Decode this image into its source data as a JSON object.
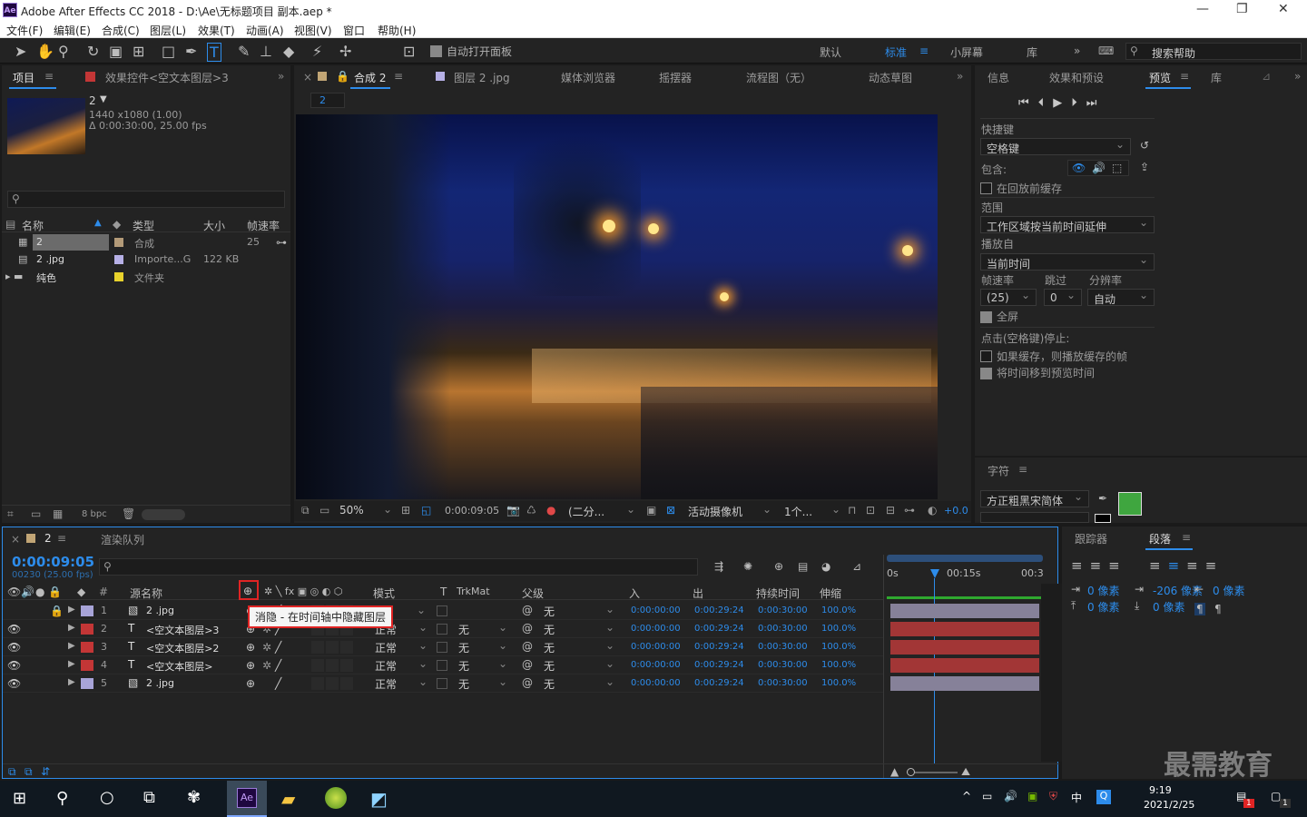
{
  "app": {
    "title": "Adobe After Effects CC 2018 - D:\\Ae\\无标题项目 副本.aep *",
    "logo_text": "Ae",
    "window_controls": [
      "—",
      "❐",
      "✕"
    ]
  },
  "menu": [
    "文件(F)",
    "编辑(E)",
    "合成(C)",
    "图层(L)",
    "效果(T)",
    "动画(A)",
    "视图(V)",
    "窗口",
    "帮助(H)"
  ],
  "toolbar": {
    "auto_open_label": "自动打开面板",
    "workspaces": [
      "默认",
      "标准",
      "小屏幕",
      "库"
    ],
    "active_workspace": "标准",
    "search_placeholder": "搜索帮助"
  },
  "project_panel": {
    "tab_project": "项目",
    "tab_effects": "效果控件<空文本图层>3",
    "selected_name": "2",
    "selected_info_1": "1440 x1080 (1.00)",
    "selected_info_2": "Δ 0:00:30:00, 25.00 fps",
    "columns": [
      "名称",
      "类型",
      "大小",
      "帧速率"
    ],
    "items": [
      {
        "name": "2",
        "type": "合成",
        "size": "",
        "fps": "25",
        "swatch": "#b39a78",
        "selected": true
      },
      {
        "name": "2 .jpg",
        "type": "Importe...G",
        "size": "122 KB",
        "fps": "",
        "swatch": "#b6b0e6",
        "selected": false
      },
      {
        "name": "纯色",
        "type": "文件夹",
        "size": "",
        "fps": "",
        "swatch": "#e8d22c",
        "selected": false
      }
    ],
    "bpc": "8 bpc"
  },
  "viewer": {
    "tab_comp": "合成 2",
    "tab_layer": "图层 2 .jpg",
    "tab_media": "媒体浏览器",
    "tab_wiggler": "摇摆器",
    "tab_flow": "流程图（无）",
    "tab_sketch": "动态草图",
    "comp_chip": "2",
    "zoom": "50%",
    "timecode": "0:00:09:05",
    "resolution": "(二分...",
    "camera": "活动摄像机",
    "views": "1个...",
    "exposure": "+0.0"
  },
  "preview_panel": {
    "tab_info": "信息",
    "tab_effects_presets": "效果和预设",
    "tab_preview": "预览",
    "tab_library": "库",
    "shortcut_label": "快捷键",
    "shortcut_value": "空格键",
    "include_label": "包含:",
    "cache_before": "在回放前缓存",
    "range_label": "范围",
    "range_value": "工作区域按当前时间延伸",
    "play_from_label": "播放自",
    "play_from_value": "当前时间",
    "fps_label": "帧速率",
    "skip_label": "跳过",
    "res_label": "分辨率",
    "fps_value": "(25)",
    "skip_value": "0",
    "res_value": "自动",
    "fullscreen_label": "全屏",
    "stop_label": "点击(空格键)停止:",
    "opt1": "如果缓存，则播放缓存的帧",
    "opt2": "将时间移到预览时间"
  },
  "character_panel": {
    "tab": "字符",
    "font": "方正粗黑宋简体",
    "fill_color": "#3fa63f"
  },
  "timeline": {
    "tab_comp": "2",
    "tab_render": "渲染队列",
    "current_time": "0:00:09:05",
    "frame_info": "00230 (25.00 fps)",
    "columns": {
      "num": "#",
      "source": "源名称",
      "mode": "模式",
      "t": "T",
      "trkmat": "TrkMat",
      "parent": "父级",
      "in": "入",
      "out": "出",
      "duration": "持续时间",
      "stretch": "伸缩"
    },
    "tooltip": "消隐 - 在时间轴中隐藏图层",
    "ruler": [
      "0s",
      "00:15s",
      "00:3"
    ],
    "layers": [
      {
        "num": "1",
        "type": "img",
        "name": "2 .jpg",
        "color": "#a8a4d8",
        "mode": "正常",
        "trk": "",
        "parent": "无",
        "in": "0:00:00:00",
        "out": "0:00:29:24",
        "dur": "0:00:30:00",
        "stretch": "100.0%",
        "bar": "#868199"
      },
      {
        "num": "2",
        "type": "T",
        "name": "<空文本图层>3",
        "color": "#c33636",
        "mode": "正常",
        "trk": "无",
        "parent": "无",
        "in": "0:00:00:00",
        "out": "0:00:29:24",
        "dur": "0:00:30:00",
        "stretch": "100.0%",
        "bar": "#a23636"
      },
      {
        "num": "3",
        "type": "T",
        "name": "<空文本图层>2",
        "color": "#c33636",
        "mode": "正常",
        "trk": "无",
        "parent": "无",
        "in": "0:00:00:00",
        "out": "0:00:29:24",
        "dur": "0:00:30:00",
        "stretch": "100.0%",
        "bar": "#a23636"
      },
      {
        "num": "4",
        "type": "T",
        "name": "<空文本图层>",
        "color": "#c33636",
        "mode": "正常",
        "trk": "无",
        "parent": "无",
        "in": "0:00:00:00",
        "out": "0:00:29:24",
        "dur": "0:00:30:00",
        "stretch": "100.0%",
        "bar": "#a23636"
      },
      {
        "num": "5",
        "type": "img",
        "name": "2 .jpg",
        "color": "#a8a4d8",
        "mode": "正常",
        "trk": "无",
        "parent": "无",
        "in": "0:00:00:00",
        "out": "0:00:29:24",
        "dur": "0:00:30:00",
        "stretch": "100.0%",
        "bar": "#868199"
      }
    ]
  },
  "right_lower": {
    "tab_tracker": "跟踪器",
    "tab_paragraph": "段落",
    "indent_left": "0 像素",
    "indent_first": "-206 像素",
    "indent_right": "0 像素",
    "space_before": "0 像素",
    "space_after": "0 像素"
  },
  "taskbar": {
    "time": "9:19",
    "date": "2021/2/25",
    "ime": "中",
    "watermark": "最需教育",
    "notify_count": "1"
  }
}
